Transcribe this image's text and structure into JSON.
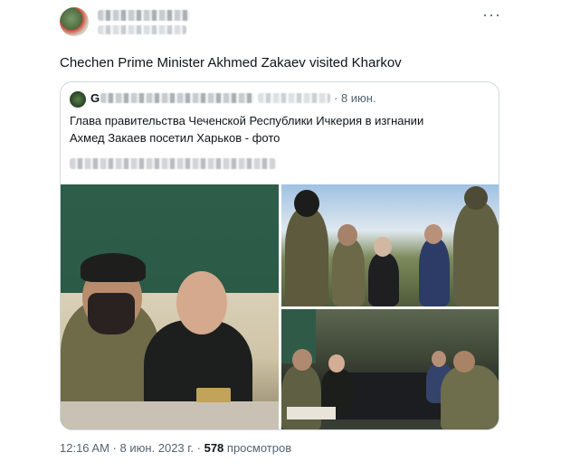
{
  "post": {
    "more_label": "···",
    "text": "Chechen Prime Minister Akhmed Zakaev visited Kharkov",
    "quoted": {
      "initial": "G",
      "date": "· 8 июн.",
      "text": "Глава правительства Чеченской Республики Ичкерия в изгнании Ахмед Закаев посетил Харьков - фото"
    },
    "meta": {
      "time": "12:16 AM · 8 июн. 2023 г. · ",
      "views_count": "578",
      "views_label": " просмотров"
    }
  },
  "icons": {
    "more": "more-horizontal-icon"
  }
}
